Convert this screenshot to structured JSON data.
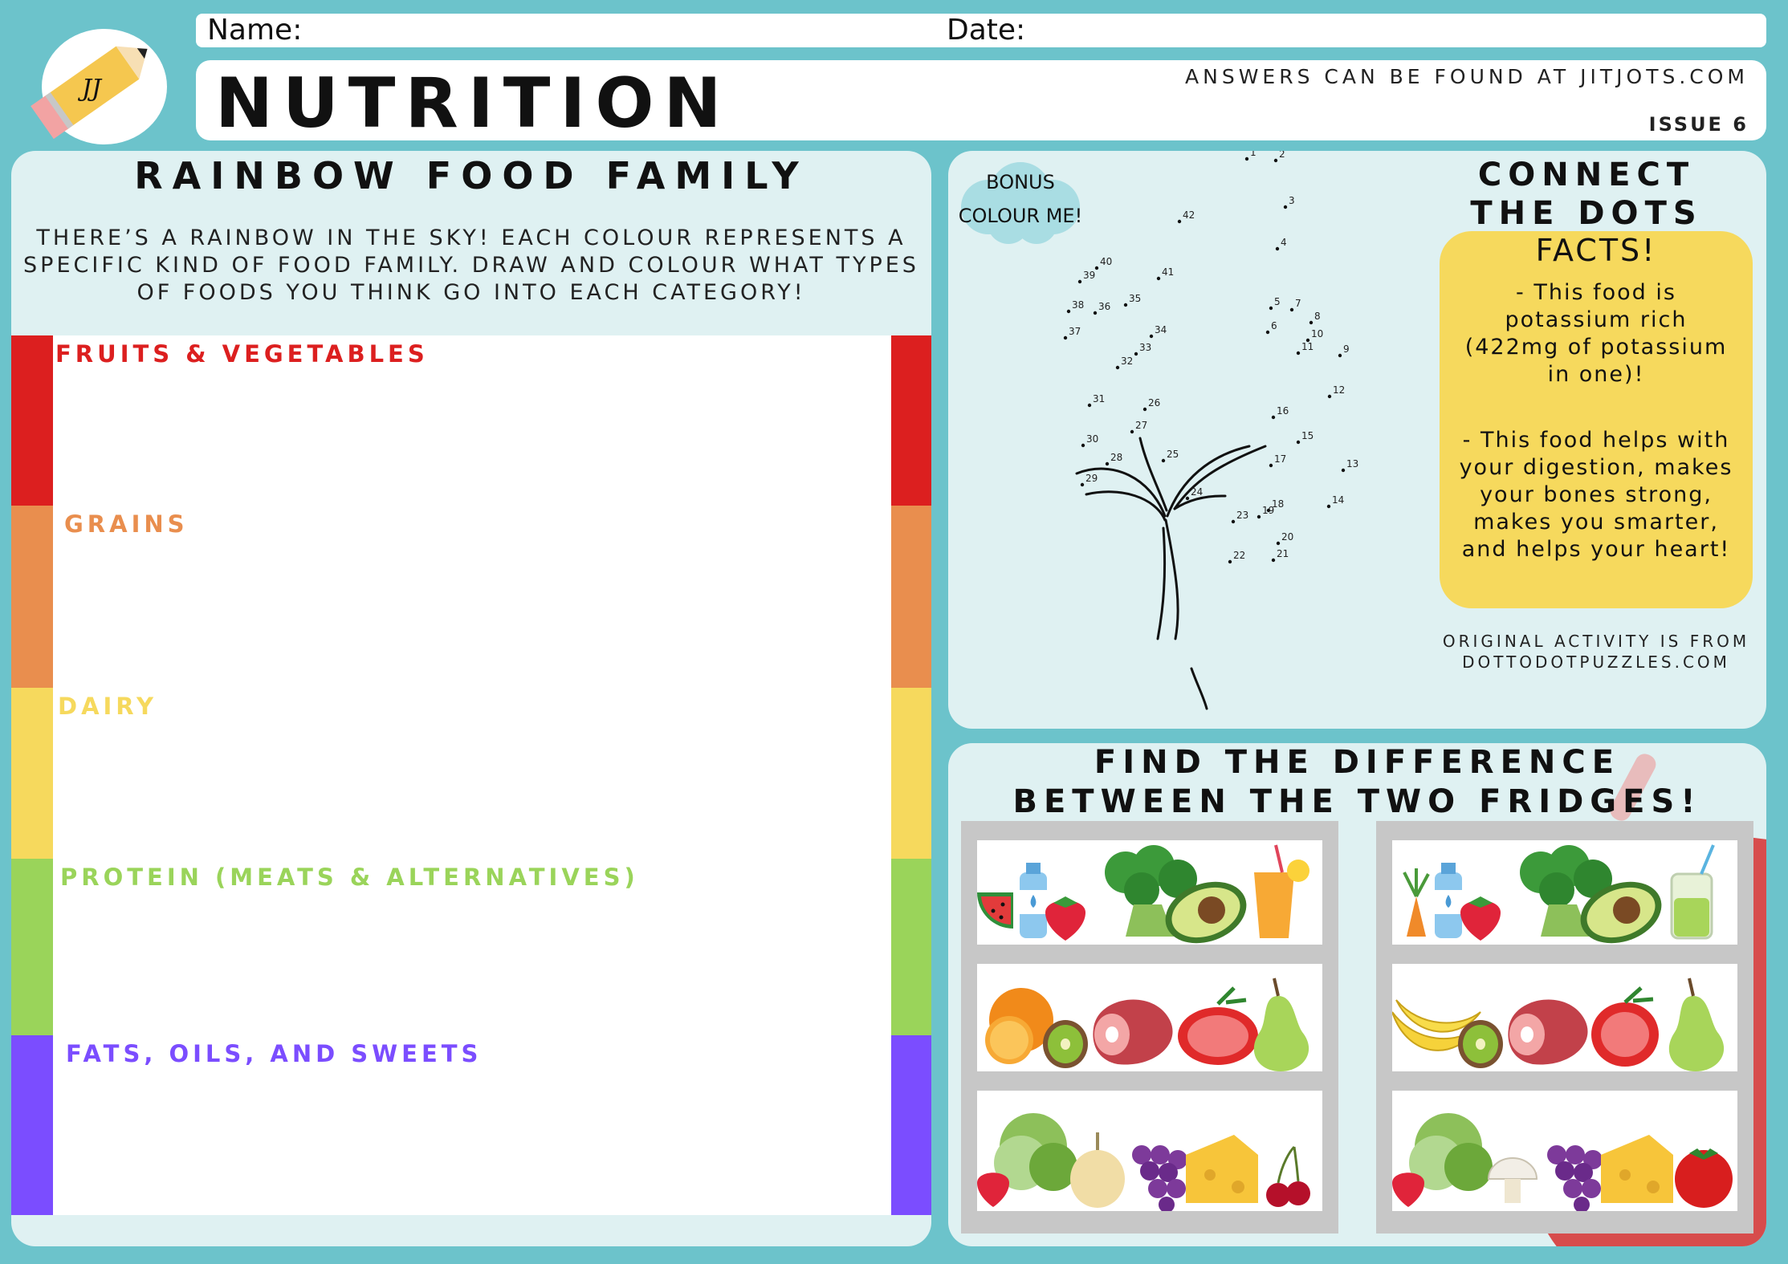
{
  "header": {
    "name_label": "Name:",
    "date_label": "Date:",
    "title": "NUTRITION",
    "answers_note": "ANSWERS CAN BE FOUND AT JITJOTS.COM",
    "issue": "ISSUE 6",
    "logo_text": "JJ"
  },
  "rainbow": {
    "title": "RAINBOW FOOD FAMILY",
    "description": "THERE’S A RAINBOW IN THE SKY! EACH COLOUR REPRESENTS A SPECIFIC KIND OF FOOD FAMILY. DRAW AND COLOUR WHAT TYPES OF FOODS YOU THINK GO INTO EACH CATEGORY!",
    "categories": [
      {
        "label": "FRUITS & VEGETABLES",
        "color": "#dc1f1f"
      },
      {
        "label": "GRAINS",
        "color": "#e98e4e"
      },
      {
        "label": "DAIRY",
        "color": "#f6d95d"
      },
      {
        "label": "PROTEIN (MEATS & ALTERNATIVES)",
        "color": "#9ad45a"
      },
      {
        "label": "FATS, OILS, AND SWEETS",
        "color": "#7b4dff"
      }
    ]
  },
  "dots": {
    "bonus_line1": "BONUS",
    "bonus_line2": "COLOUR ME!",
    "title": "CONNECT THE DOTS",
    "facts_title": "FACTS!",
    "fact1": "- This food is potassium rich (422mg of potassium in one)!",
    "fact2": "- This food helps with your digestion, makes your bones strong, makes you smarter, and helps your heart!",
    "credit": "ORIGINAL ACTIVITY IS FROM DOTTODOTPUZZLES.COM",
    "numbers": [
      "1",
      "2",
      "3",
      "4",
      "5",
      "6",
      "7",
      "8",
      "9",
      "10",
      "11",
      "12",
      "13",
      "14",
      "15",
      "16",
      "17",
      "18",
      "19",
      "20",
      "21",
      "22",
      "23",
      "24",
      "25",
      "26",
      "27",
      "28",
      "29",
      "30",
      "31",
      "32",
      "33",
      "34",
      "35",
      "36",
      "37",
      "38",
      "39",
      "40",
      "41",
      "42"
    ]
  },
  "fridges": {
    "title_line1": "FIND THE DIFFERENCE",
    "title_line2": "BETWEEN THE TWO FRIDGES!",
    "left": {
      "top": [
        "watermelon",
        "water-bottle",
        "strawberry",
        "broccoli",
        "avocado",
        "orange-juice"
      ],
      "middle": [
        "orange",
        "kiwi",
        "ham",
        "tomato",
        "pear"
      ],
      "bottom": [
        "strawberry",
        "lettuce",
        "onion",
        "grapes",
        "cheese",
        "cherries"
      ]
    },
    "right": {
      "top": [
        "carrot",
        "water-bottle",
        "strawberry",
        "broccoli",
        "avocado",
        "green-smoothie"
      ],
      "middle": [
        "banana",
        "kiwi",
        "ham",
        "tomato",
        "pear"
      ],
      "bottom": [
        "strawberry",
        "lettuce",
        "mushroom",
        "grapes",
        "cheese",
        "tomato"
      ]
    }
  }
}
